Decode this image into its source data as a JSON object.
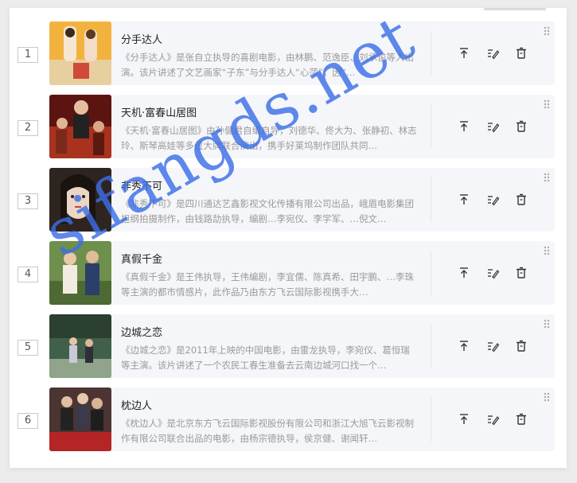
{
  "list": {
    "items": [
      {
        "index": "1",
        "title": "分手达人",
        "description": "《分手达人》是张自立执导的喜剧电影，由林鹏、范逸臣、刘承俊等人出演。该片讲述了文艺画家“子东”与分手达人“心萍”，因“…",
        "poster_colors": [
          "#f0b640",
          "#e8d7b0"
        ]
      },
      {
        "index": "2",
        "title": "天机·富春山居图",
        "description": "《天机·富春山居图》由孙健君自编自导，刘德华、佟大为、张静初、林志玲、斯琴高娃等多位大牌联合演出，携手好莱坞制作团队共同…",
        "poster_colors": [
          "#6a1a16",
          "#c0472a"
        ]
      },
      {
        "index": "3",
        "title": "非秀不可",
        "description": "《非秀不可》是四川通达艺鑫影视文化传播有限公司出品，峨眉电影集团担纲拍摄制作，由钱路劼执导，编剧…李宛仪、李学军、…倪文…",
        "poster_colors": [
          "#3a2a22",
          "#e8d2c0"
        ]
      },
      {
        "index": "4",
        "title": "真假千金",
        "description": "《真假千金》是王伟执导，王伟编剧，李宜儒、陈真希、田宇鹏、…李珠等主演的都市情感片，此作品乃由东方飞云国际影视携手大…",
        "poster_colors": [
          "#6a8a4a",
          "#e6dfc8"
        ]
      },
      {
        "index": "5",
        "title": "边城之恋",
        "description": "《边城之恋》是2011年上映的中国电影，由雷龙执导，李宛仪、葛恒瑞等主演。该片讲述了一个农民工春生准备去云南边城河口找一个…",
        "poster_colors": [
          "#3f5c40",
          "#a9b79a"
        ]
      },
      {
        "index": "6",
        "title": "枕边人",
        "description": "《枕边人》是北京东方飞云国际影视股份有限公司和浙江大旭飞云影视制作有限公司联合出品的电影，由杨宗德执导，侯京健、谢闻轩…",
        "poster_colors": [
          "#5a3b3a",
          "#c32c2c"
        ]
      }
    ]
  },
  "watermark": "sifangds.net"
}
